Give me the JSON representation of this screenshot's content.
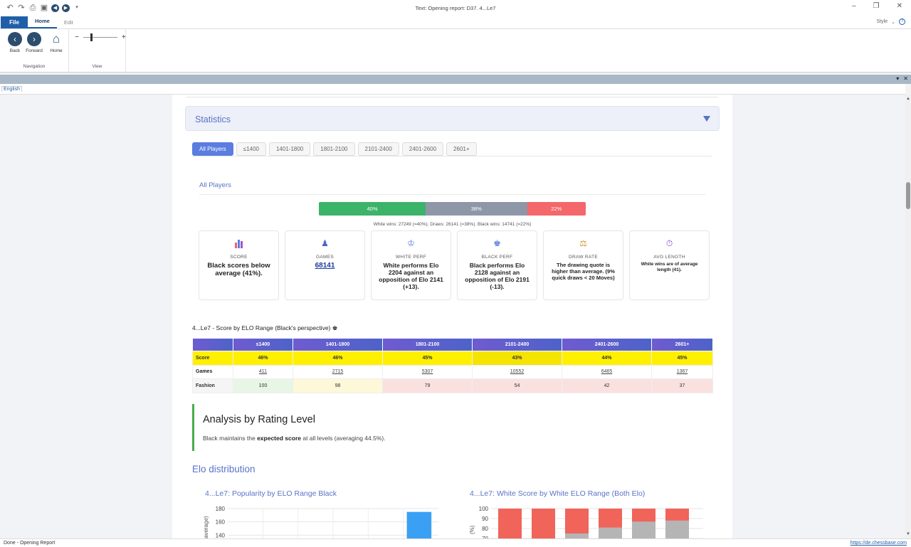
{
  "window": {
    "title": "Text: Opening report: D37.   4...Le7"
  },
  "ribbon": {
    "file_tab": "File",
    "tabs": [
      "Home",
      "Edit"
    ],
    "style_label": "Style",
    "buttons": {
      "back": "Back",
      "forward": "Forward",
      "home": "Home"
    },
    "groups": {
      "navigation": "Navigation",
      "view": "View"
    },
    "zoom_minus": "−",
    "zoom_plus": "+"
  },
  "language_tab": "English",
  "report": {
    "section_title": "Statistics",
    "filters": [
      "All Players",
      "≤1400",
      "1401-1800",
      "1801-2100",
      "2101-2400",
      "2401-2600",
      "2601+"
    ],
    "active_filter": "All Players",
    "results_bar": {
      "white": "40%",
      "draws": "38%",
      "black": "22%"
    },
    "results_text": "White wins: 27249 (=40%). Draws: 26141 (=38%). Black wins: 14741 (=22%)",
    "results_values": {
      "white_pct": 40,
      "draws_pct": 38,
      "black_pct": 22
    },
    "cards": [
      {
        "icon": "bar-chart-icon",
        "label": "SCORE",
        "value": "Black scores below average (41%)."
      },
      {
        "icon": "pawn-icon",
        "label": "GAMES",
        "value": "68141"
      },
      {
        "icon": "white-king-icon",
        "label": "WHITE PERF",
        "value": "White performs Elo 2204 against an opposition of Elo 2141 (+13)."
      },
      {
        "icon": "black-king-icon",
        "label": "BLACK PERF",
        "value": "Black performs Elo 2128 against an opposition of Elo 2191 (-13)."
      },
      {
        "icon": "scales-icon",
        "label": "DRAW RATE",
        "value": "The drawing quote is higher than average. (9% quick draws < 20 Moves)"
      },
      {
        "icon": "stopwatch-icon",
        "label": "AVG LENGTH",
        "value": "White wins are of average length (41)."
      }
    ],
    "elo_table": {
      "title": "4...Le7 - Score by ELO Range (Black's perspective)",
      "title_icon": "♚",
      "columns": [
        "≤1400",
        "1401-1800",
        "1801-2100",
        "2101-2400",
        "2401-2600",
        "2601+"
      ],
      "rows": [
        {
          "label": "Score",
          "values": [
            "46%",
            "46%",
            "45%",
            "43%",
            "44%",
            "45%"
          ]
        },
        {
          "label": "Games",
          "values": [
            "411",
            "2715",
            "5307",
            "10552",
            "6465",
            "1367"
          ]
        },
        {
          "label": "Fashion",
          "values": [
            "100",
            "98",
            "79",
            "54",
            "42",
            "37"
          ]
        }
      ]
    },
    "analysis": {
      "heading": "Analysis by Rating Level",
      "text_before": "Black maintains the ",
      "text_bold": "expected score",
      "text_after": " at all levels (averaging 44.5%)."
    },
    "elo_distribution": "Elo distribution",
    "chart_data": [
      {
        "type": "bar",
        "title": "4...Le7: Popularity by ELO Range Black",
        "ylabel": "average)",
        "yticks": [
          180,
          160,
          140
        ],
        "ylim": [
          120,
          180
        ],
        "values": [
          null,
          null,
          null,
          null,
          null,
          175
        ],
        "colors": {
          "bar": "#3aa0f3"
        }
      },
      {
        "type": "bar",
        "title": "4...Le7: White Score by White ELO Range (Both Elo)",
        "ylabel": "(%)",
        "yticks": [
          100,
          90,
          80,
          70
        ],
        "ylim": [
          70,
          100
        ],
        "series": [
          {
            "color": "#f0645a",
            "values": [
              100,
              100,
              100,
              100,
              100,
              100
            ]
          },
          {
            "color": "#b5b5b5",
            "values": [
              0,
              0,
              75,
              81,
              87,
              88
            ]
          }
        ]
      }
    ]
  },
  "status": {
    "left": "Done - Opening Report",
    "right": "https://de.chessbase.com"
  },
  "colors": {
    "win": "#3db369",
    "draw": "#8d97a8",
    "loss": "#f4676b",
    "accent": "#5973c8"
  }
}
